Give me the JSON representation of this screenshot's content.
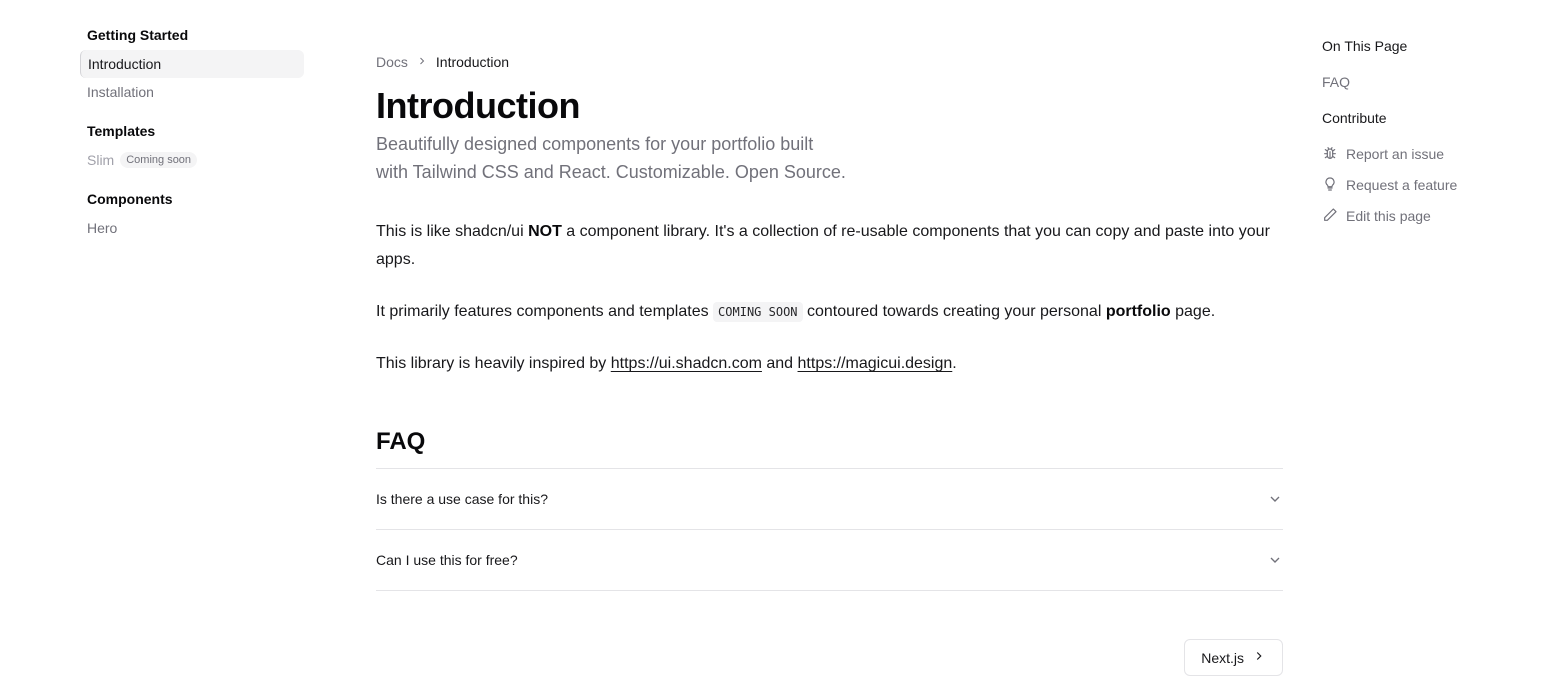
{
  "sidebar": {
    "groups": [
      {
        "heading": "Getting Started",
        "items": [
          {
            "label": "Introduction"
          },
          {
            "label": "Installation"
          }
        ]
      },
      {
        "heading": "Templates",
        "items": [
          {
            "label": "Slim",
            "badge": "Coming soon"
          }
        ]
      },
      {
        "heading": "Components",
        "items": [
          {
            "label": "Hero"
          }
        ]
      }
    ]
  },
  "breadcrumb": {
    "root": "Docs",
    "current": "Introduction"
  },
  "main": {
    "title": "Introduction",
    "lead_line1": "Beautifully designed components for your portfolio built",
    "lead_line2": "with Tailwind CSS and React. Customizable. Open Source.",
    "p1": {
      "pre": "This is like shadcn/ui ",
      "bold": "NOT",
      "post": " a component library. It's a collection of re-usable components that you can copy and paste into your apps."
    },
    "p2": {
      "pre": "It primarily features components and templates ",
      "code": "COMING SOON",
      "mid": " contoured towards creating your personal ",
      "bold": "portfolio",
      "post": " page."
    },
    "p3": {
      "pre": "This library is heavily inspired by ",
      "link1": "https://ui.shadcn.com",
      "mid": " and ",
      "link2": "https://magicui.design",
      "post": "."
    },
    "faq_title": "FAQ",
    "faq": [
      {
        "question": "Is there a use case for this?"
      },
      {
        "question": "Can I use this for free?"
      }
    ],
    "next_label": "Next.js"
  },
  "toc": {
    "heading": "On This Page",
    "links": [
      "FAQ"
    ],
    "contribute_heading": "Contribute",
    "contribute": [
      {
        "label": "Report an issue",
        "icon": "bug-icon"
      },
      {
        "label": "Request a feature",
        "icon": "lightbulb-icon"
      },
      {
        "label": "Edit this page",
        "icon": "pencil-icon"
      }
    ]
  },
  "colors": {
    "text": "#18181b",
    "muted": "#71717a",
    "border": "#e4e4e7",
    "active_bg": "#f4f4f5"
  }
}
